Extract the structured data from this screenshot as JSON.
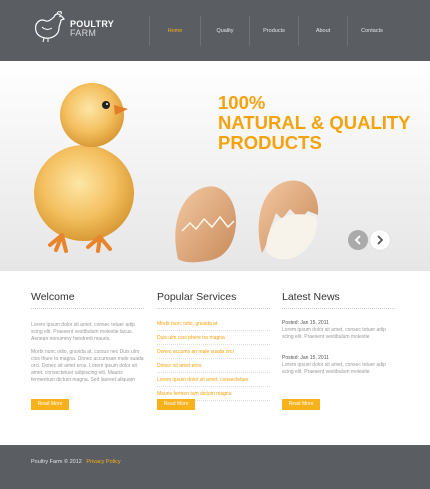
{
  "logo": {
    "line1": "POULTRY",
    "line2": "FARM",
    "icon": "hen-icon"
  },
  "nav": {
    "items": [
      {
        "label": "Home",
        "active": true
      },
      {
        "label": "Quality",
        "active": false
      },
      {
        "label": "Products",
        "active": false
      },
      {
        "label": "About",
        "active": false
      },
      {
        "label": "Contacts",
        "active": false
      }
    ]
  },
  "hero": {
    "line1": "100%",
    "line2": "NATURAL & QUALITY",
    "line3": "PRODUCTS",
    "accent": "#f5a20f"
  },
  "welcome": {
    "title": "Welcome",
    "para1": "Lorem ipsum dolor sit amet, consec tetuer adip scing elit. Praesent vestibulum molestie lacus. Aenean nonummy hendrerit mauris.",
    "para2": "Morbi nunc odio, gravida at, cursus nec Duis ulm cios thure to magna. Donec accumsan male suada orci. Donec sit amet eros. Lorem ipsum dolor sit amet, consectetuer adipiscing elit. Mauris fermentum dictum magna. Sed laoreet aliquam",
    "button": "Read More"
  },
  "services": {
    "title": "Popular Services",
    "items": [
      "Morbi nunc odio, gravida at",
      "Duis ulm cios phere tro magna",
      "Donec accums an male suada orci",
      "Donec sit amet eros",
      "Lorem ipsum dolor sit amet, consectetuer",
      "Mauris fermen tum dictum magna"
    ],
    "button": "Read More"
  },
  "news": {
    "title": "Latest News",
    "items": [
      {
        "date": "Posted: Jan 15, 2011",
        "text": "Lorem ipsum dolor sit amet, consec tetuer adip scing elit. Praesent vestibulum molestie"
      },
      {
        "date": "Posted: Jan 15, 2011",
        "text": "Lorem ipsum dolor sit amet, consec tetuer adip scing elit. Praesent vestibulum molestie"
      }
    ],
    "button": "Read More"
  },
  "footer": {
    "copyright": "Poultry Farm © 2012",
    "link": "Privacy Policy"
  }
}
